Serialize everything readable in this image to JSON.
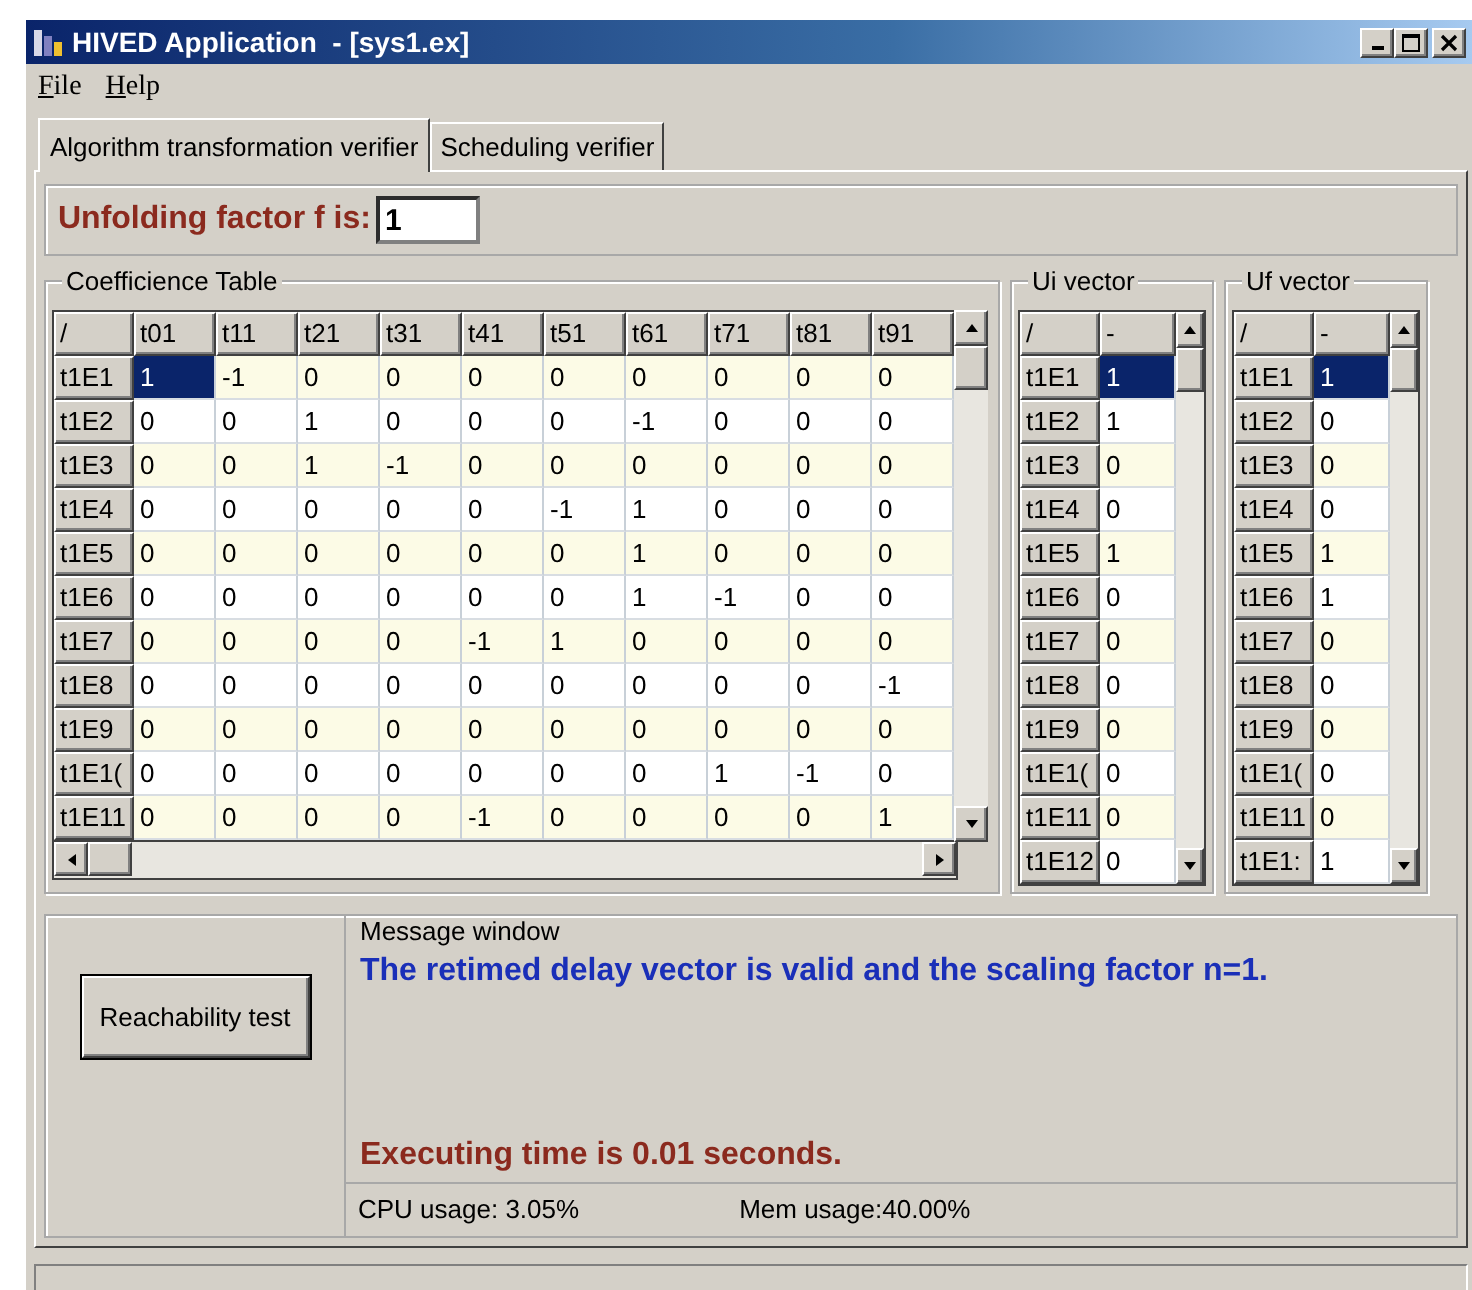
{
  "window": {
    "title": "HIVED Application  - [sys1.ex]"
  },
  "menu": [
    "File",
    "Help"
  ],
  "tabs": [
    {
      "label": "Algorithm transformation verifier",
      "selected": true
    },
    {
      "label": "Scheduling verifier",
      "selected": false
    }
  ],
  "unfolding": {
    "label": "Unfolding factor f is:",
    "value": "1"
  },
  "coefficient_table": {
    "title": "Coefficience Table",
    "corner": "/",
    "columns": [
      "t01",
      "t11",
      "t21",
      "t31",
      "t41",
      "t51",
      "t61",
      "t71",
      "t81",
      "t91"
    ],
    "rows": [
      {
        "header": "t1E1",
        "selected": true,
        "cells": [
          "1",
          "-1",
          "0",
          "0",
          "0",
          "0",
          "0",
          "0",
          "0",
          "0"
        ]
      },
      {
        "header": "t1E2",
        "selected": false,
        "cells": [
          "0",
          "0",
          "1",
          "0",
          "0",
          "0",
          "-1",
          "0",
          "0",
          "0"
        ]
      },
      {
        "header": "t1E3",
        "selected": false,
        "cells": [
          "0",
          "0",
          "1",
          "-1",
          "0",
          "0",
          "0",
          "0",
          "0",
          "0"
        ]
      },
      {
        "header": "t1E4",
        "selected": false,
        "cells": [
          "0",
          "0",
          "0",
          "0",
          "0",
          "-1",
          "1",
          "0",
          "0",
          "0"
        ]
      },
      {
        "header": "t1E5",
        "selected": false,
        "cells": [
          "0",
          "0",
          "0",
          "0",
          "0",
          "0",
          "1",
          "0",
          "0",
          "0"
        ]
      },
      {
        "header": "t1E6",
        "selected": false,
        "cells": [
          "0",
          "0",
          "0",
          "0",
          "0",
          "0",
          "1",
          "-1",
          "0",
          "0"
        ]
      },
      {
        "header": "t1E7",
        "selected": false,
        "cells": [
          "0",
          "0",
          "0",
          "0",
          "-1",
          "1",
          "0",
          "0",
          "0",
          "0"
        ]
      },
      {
        "header": "t1E8",
        "selected": false,
        "cells": [
          "0",
          "0",
          "0",
          "0",
          "0",
          "0",
          "0",
          "0",
          "0",
          "-1"
        ]
      },
      {
        "header": "t1E9",
        "selected": false,
        "cells": [
          "0",
          "0",
          "0",
          "0",
          "0",
          "0",
          "0",
          "0",
          "0",
          "0"
        ]
      },
      {
        "header": "t1E1(",
        "selected": false,
        "cells": [
          "0",
          "0",
          "0",
          "0",
          "0",
          "0",
          "0",
          "1",
          "-1",
          "0"
        ]
      },
      {
        "header": "t1E11",
        "selected": false,
        "cells": [
          "0",
          "0",
          "0",
          "0",
          "-1",
          "0",
          "0",
          "0",
          "0",
          "1"
        ]
      }
    ]
  },
  "vectors": [
    {
      "title": "Ui vector",
      "corner": "/",
      "column": "-",
      "rows": [
        {
          "header": "t1E1",
          "value": "1",
          "selected": true
        },
        {
          "header": "t1E2",
          "value": "1",
          "selected": false
        },
        {
          "header": "t1E3",
          "value": "0",
          "selected": false
        },
        {
          "header": "t1E4",
          "value": "0",
          "selected": false
        },
        {
          "header": "t1E5",
          "value": "1",
          "selected": false
        },
        {
          "header": "t1E6",
          "value": "0",
          "selected": false
        },
        {
          "header": "t1E7",
          "value": "0",
          "selected": false
        },
        {
          "header": "t1E8",
          "value": "0",
          "selected": false
        },
        {
          "header": "t1E9",
          "value": "0",
          "selected": false
        },
        {
          "header": "t1E1(",
          "value": "0",
          "selected": false
        },
        {
          "header": "t1E11",
          "value": "0",
          "selected": false
        },
        {
          "header": "t1E12",
          "value": "0",
          "selected": false
        }
      ]
    },
    {
      "title": "Uf vector",
      "corner": "/",
      "column": "-",
      "rows": [
        {
          "header": "t1E1",
          "value": "1",
          "selected": true
        },
        {
          "header": "t1E2",
          "value": "0",
          "selected": false
        },
        {
          "header": "t1E3",
          "value": "0",
          "selected": false
        },
        {
          "header": "t1E4",
          "value": "0",
          "selected": false
        },
        {
          "header": "t1E5",
          "value": "1",
          "selected": false
        },
        {
          "header": "t1E6",
          "value": "1",
          "selected": false
        },
        {
          "header": "t1E7",
          "value": "0",
          "selected": false
        },
        {
          "header": "t1E8",
          "value": "0",
          "selected": false
        },
        {
          "header": "t1E9",
          "value": "0",
          "selected": false
        },
        {
          "header": "t1E1(",
          "value": "0",
          "selected": false
        },
        {
          "header": "t1E11",
          "value": "0",
          "selected": false
        },
        {
          "header": "t1E1:",
          "value": "1",
          "selected": false
        }
      ]
    }
  ],
  "action_button": "Reachability test",
  "message_window": {
    "title": "Message window",
    "message": "The retimed delay vector is valid and the scaling factor n=1.",
    "executing_time": "Executing time is 0.01 seconds.",
    "cpu_usage": "CPU usage: 3.05%",
    "mem_usage": "Mem usage:40.00%"
  }
}
